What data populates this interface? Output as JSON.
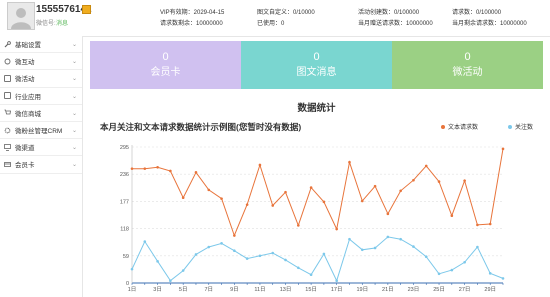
{
  "header": {
    "account": "1555576142",
    "wx_label": "微信号:",
    "wx_value": "消息",
    "stats": [
      {
        "k": "VIP有效期：",
        "v": "2029-04-15"
      },
      {
        "k": "图文自定义：",
        "v": "0/10000"
      },
      {
        "k": "活动创建数：",
        "v": "0/100000"
      },
      {
        "k": "请求数：",
        "v": "0/100000"
      },
      {
        "k": "请求数剩余：",
        "v": "10000000"
      },
      {
        "k": "已使用：",
        "v": "0"
      },
      {
        "k": "当月赠送请求数：",
        "v": "10000000"
      },
      {
        "k": "当月剩余请求数：",
        "v": "10000000"
      }
    ]
  },
  "sidebar": {
    "items": [
      {
        "label": "基础设置",
        "icon": "wrench-icon"
      },
      {
        "label": "微互动",
        "icon": "refresh-icon"
      },
      {
        "label": "微活动",
        "icon": "gift-icon"
      },
      {
        "label": "行业应用",
        "icon": "document-icon"
      },
      {
        "label": "微信商城",
        "icon": "cart-icon"
      },
      {
        "label": "微粉丝管理CRM",
        "icon": "gear-icon"
      },
      {
        "label": "微渠道",
        "icon": "network-icon"
      },
      {
        "label": "会员卡",
        "icon": "card-icon"
      }
    ]
  },
  "tiles": [
    {
      "num": "0",
      "label": "会员卡",
      "color": "#d0c1f0"
    },
    {
      "num": "0",
      "label": "图文消息",
      "color": "#7ad6d0"
    },
    {
      "num": "0",
      "label": "微活动",
      "color": "#9bd084"
    }
  ],
  "chart_title": "数据统计",
  "chart_subtitle": "本月关注和文本请求数据统计示例图(您暂时没有数据)",
  "colors": {
    "series1": "#e8743b",
    "series2": "#7cc8ea",
    "axis": "#666",
    "grid": "#e0e0e0"
  },
  "chart_data": {
    "type": "line",
    "x": [
      "1日",
      "2日",
      "3日",
      "4日",
      "5日",
      "6日",
      "7日",
      "8日",
      "9日",
      "10日",
      "11日",
      "12日",
      "13日",
      "14日",
      "15日",
      "16日",
      "17日",
      "18日",
      "19日",
      "20日",
      "21日",
      "22日",
      "23日",
      "24日",
      "25日",
      "26日",
      "27日",
      "28日",
      "29日",
      "30日"
    ],
    "tick_labels": [
      "1日",
      "3日",
      "5日",
      "7日",
      "9日",
      "11日",
      "13日",
      "15日",
      "17日",
      "19日",
      "21日",
      "23日",
      "25日",
      "27日",
      "29日"
    ],
    "y_ticks": [
      0,
      59,
      118,
      177,
      236,
      295
    ],
    "ylim": [
      0,
      295
    ],
    "grid": true,
    "legend": "top-right",
    "series": [
      {
        "name": "文本请求数",
        "values": [
          248,
          248,
          251,
          243,
          185,
          240,
          202,
          183,
          103,
          170,
          256,
          168,
          197,
          125,
          207,
          176,
          117,
          262,
          178,
          210,
          150,
          200,
          223,
          254,
          220,
          146,
          222,
          126,
          128,
          291
        ]
      },
      {
        "name": "关注数",
        "values": [
          30,
          90,
          47,
          5,
          27,
          62,
          78,
          86,
          70,
          53,
          59,
          65,
          50,
          33,
          18,
          63,
          5,
          95,
          72,
          76,
          100,
          95,
          79,
          57,
          20,
          28,
          45,
          78,
          21,
          10
        ]
      }
    ]
  }
}
